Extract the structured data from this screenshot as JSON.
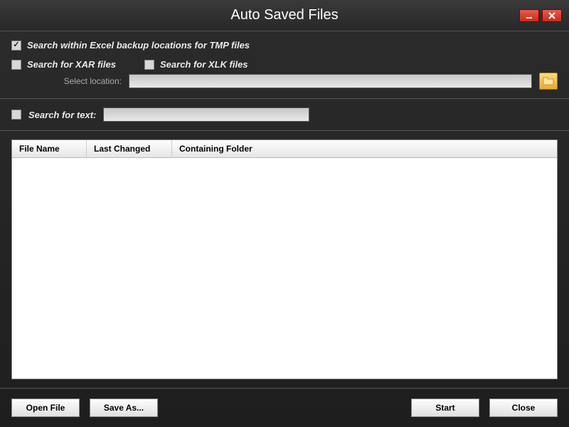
{
  "title": "Auto Saved Files",
  "checkboxes": {
    "tmp": {
      "label": "Search within Excel backup locations for TMP files",
      "checked": true
    },
    "xar": {
      "label": "Search for XAR files",
      "checked": false
    },
    "xlk": {
      "label": "Search for XLK files",
      "checked": false
    },
    "text": {
      "label": "Search for text:",
      "checked": false
    }
  },
  "location": {
    "label": "Select location:",
    "value": ""
  },
  "searchText": {
    "value": ""
  },
  "table": {
    "columns": [
      "File Name",
      "Last Changed",
      "Containing Folder"
    ]
  },
  "buttons": {
    "openFile": "Open File",
    "saveAs": "Save As...",
    "start": "Start",
    "close": "Close"
  }
}
